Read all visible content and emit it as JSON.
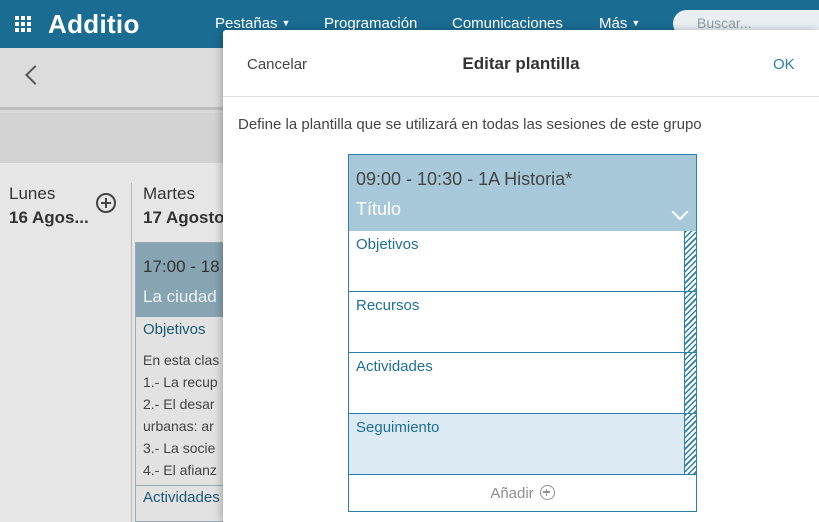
{
  "app": {
    "logo": "Additio",
    "nav": [
      {
        "label": "Pestañas",
        "has_caret": true
      },
      {
        "label": "Programación",
        "has_caret": false
      },
      {
        "label": "Comunicaciones",
        "has_caret": false
      },
      {
        "label": "Más",
        "has_caret": true
      }
    ],
    "search_placeholder": "Buscar...",
    "accent_color": "#1b6c93"
  },
  "calendar": {
    "days": [
      {
        "name": "Lunes",
        "date": "16 Agos..."
      },
      {
        "name": "Martes",
        "date": "17 Agosto"
      }
    ],
    "event": {
      "time": "17:00 - 18",
      "title": "La ciudad",
      "sections": [
        "Objetivos",
        "Actividades"
      ],
      "lines": [
        "En esta clas",
        "1.- La recup",
        "2.- El desar",
        "urbanas: ar",
        "3.- La socie",
        "4.- El afianz"
      ]
    }
  },
  "modal": {
    "cancel_label": "Cancelar",
    "title": "Editar plantilla",
    "ok_label": "OK",
    "description": "Define la plantilla que se utilizará en todas las sesiones de este grupo",
    "template": {
      "time_group": "09:00 - 10:30  -  1A Historia*",
      "title": "Título",
      "sections": [
        {
          "label": "Objetivos",
          "active": false
        },
        {
          "label": "Recursos",
          "active": false
        },
        {
          "label": "Actividades",
          "active": false
        },
        {
          "label": "Seguimiento",
          "active": true
        }
      ],
      "add_label": "Añadir"
    }
  }
}
